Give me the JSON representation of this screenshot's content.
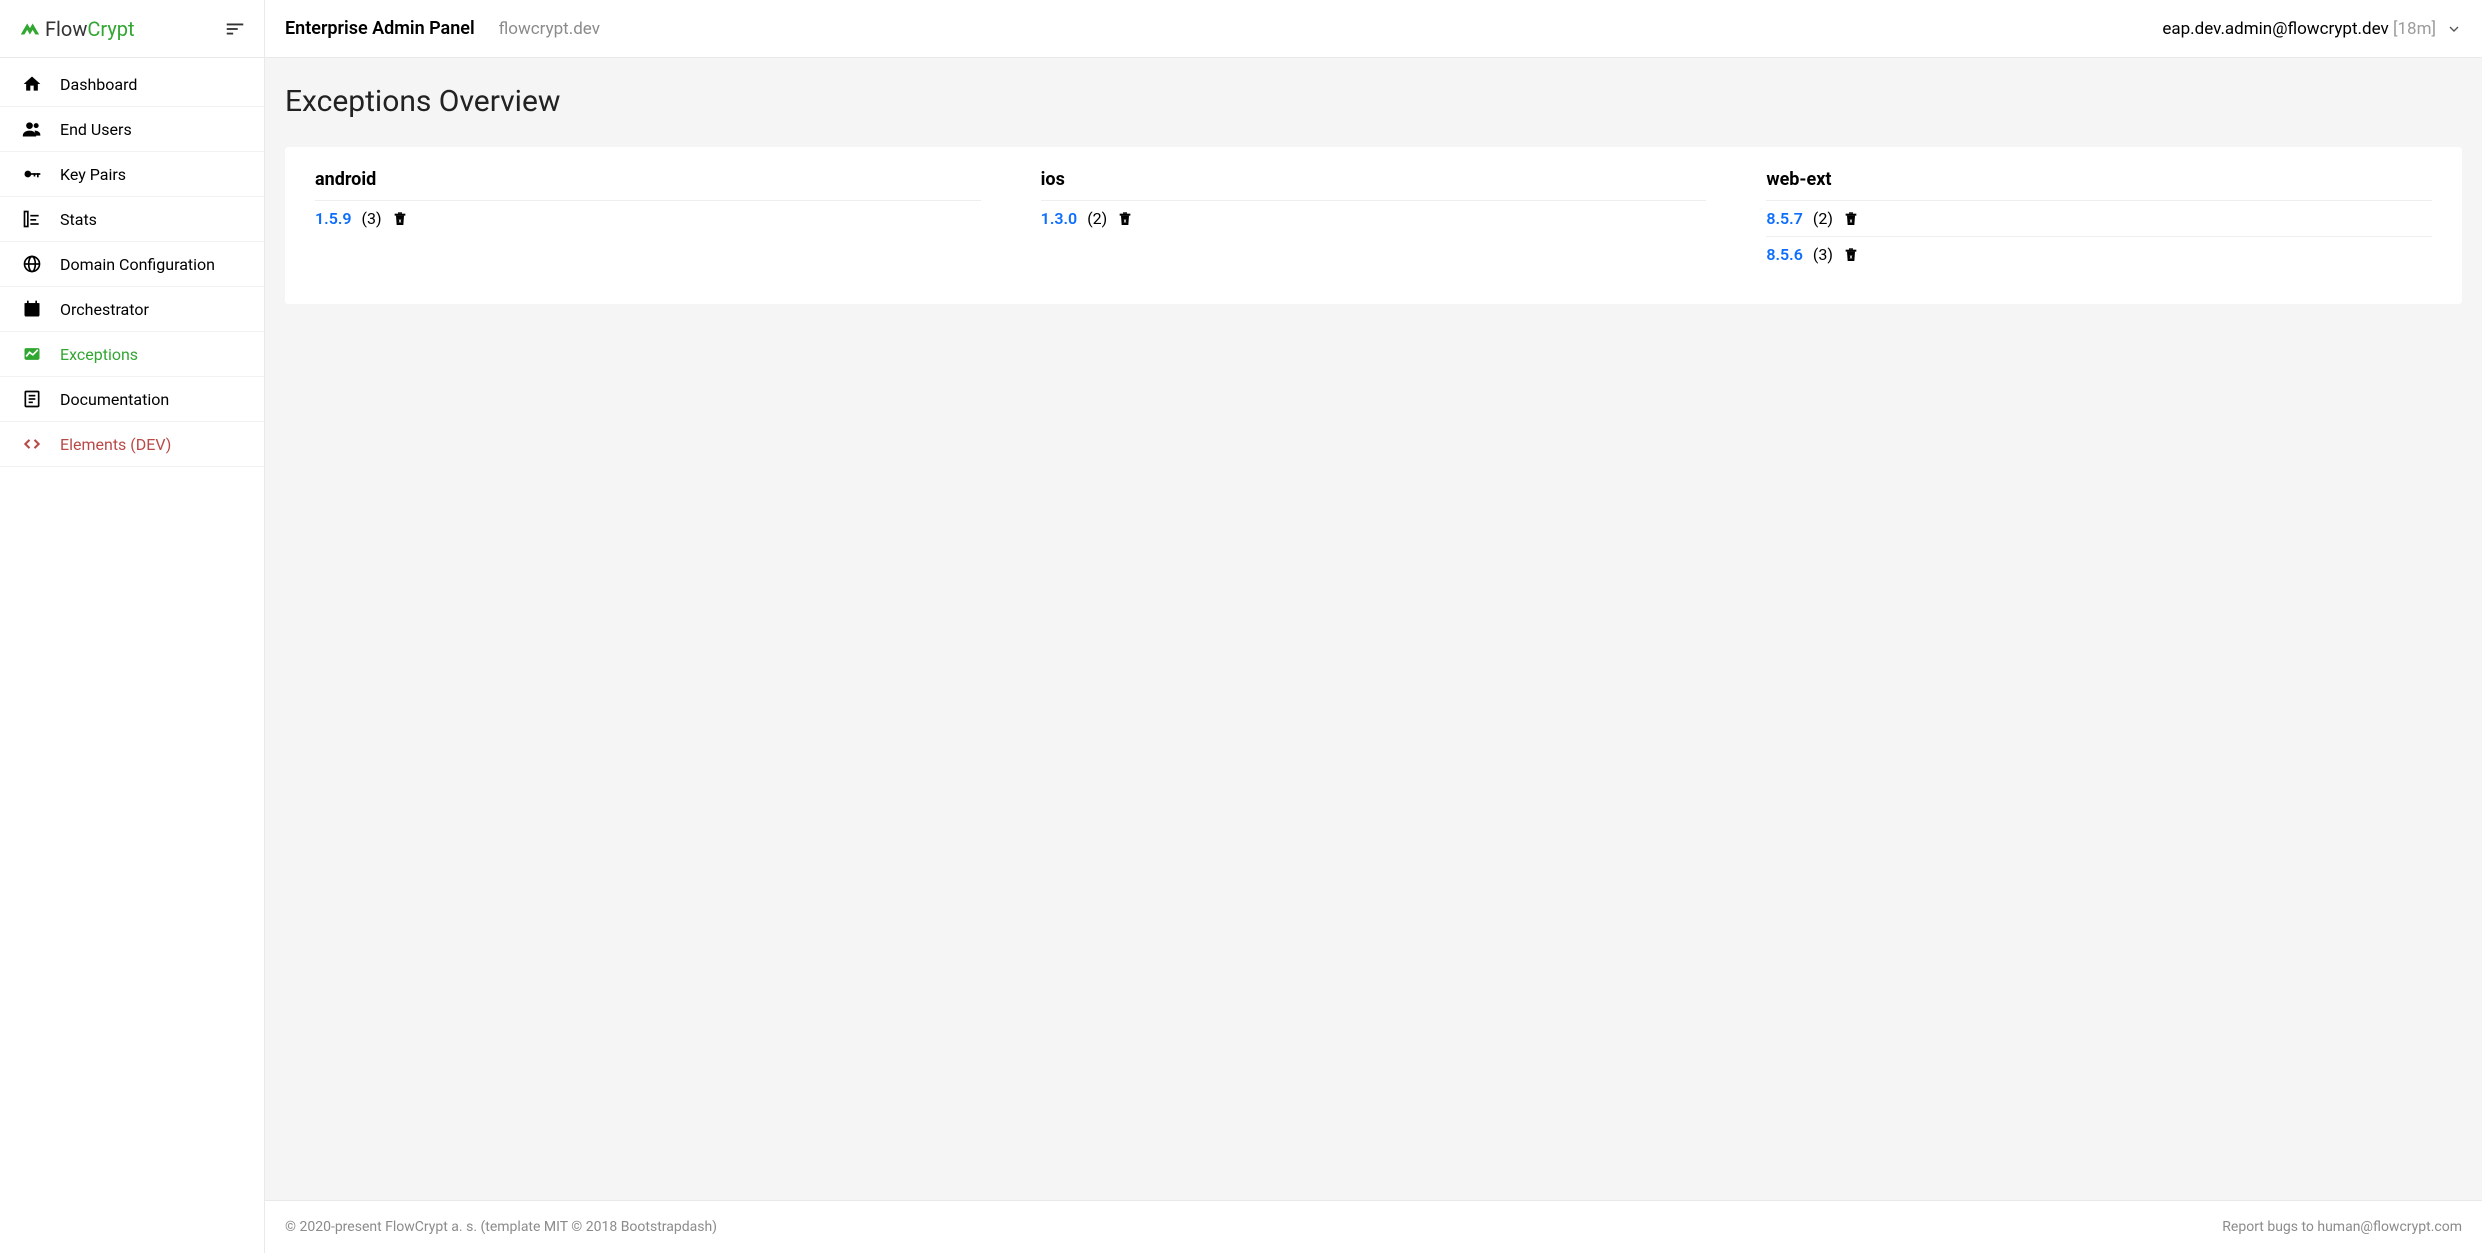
{
  "brand": {
    "flow": "Flow",
    "crypt": "Crypt"
  },
  "header": {
    "title": "Enterprise Admin Panel",
    "domain": "flowcrypt.dev",
    "user_email": "eap.dev.admin@flowcrypt.dev",
    "user_time": "[18m]"
  },
  "sidebar": {
    "items": [
      {
        "label": "Dashboard",
        "icon": "home"
      },
      {
        "label": "End Users",
        "icon": "people"
      },
      {
        "label": "Key Pairs",
        "icon": "key"
      },
      {
        "label": "Stats",
        "icon": "stats"
      },
      {
        "label": "Domain Configuration",
        "icon": "globe"
      },
      {
        "label": "Orchestrator",
        "icon": "calendar"
      },
      {
        "label": "Exceptions",
        "icon": "chart",
        "active": true
      },
      {
        "label": "Documentation",
        "icon": "doc"
      },
      {
        "label": "Elements (DEV)",
        "icon": "code",
        "dev": true
      }
    ]
  },
  "page": {
    "title": "Exceptions Overview"
  },
  "exceptions": {
    "columns": [
      {
        "name": "android",
        "rows": [
          {
            "version": "1.5.9",
            "count": "(3)"
          }
        ]
      },
      {
        "name": "ios",
        "rows": [
          {
            "version": "1.3.0",
            "count": "(2)"
          }
        ]
      },
      {
        "name": "web-ext",
        "rows": [
          {
            "version": "8.5.7",
            "count": "(2)"
          },
          {
            "version": "8.5.6",
            "count": "(3)"
          }
        ]
      }
    ]
  },
  "footer": {
    "copyright": "© 2020-present FlowCrypt a. s. (template MIT © 2018 Bootstrapdash)",
    "bugs_prefix": "Report bugs to ",
    "bugs_email": "human@flowcrypt.com"
  }
}
